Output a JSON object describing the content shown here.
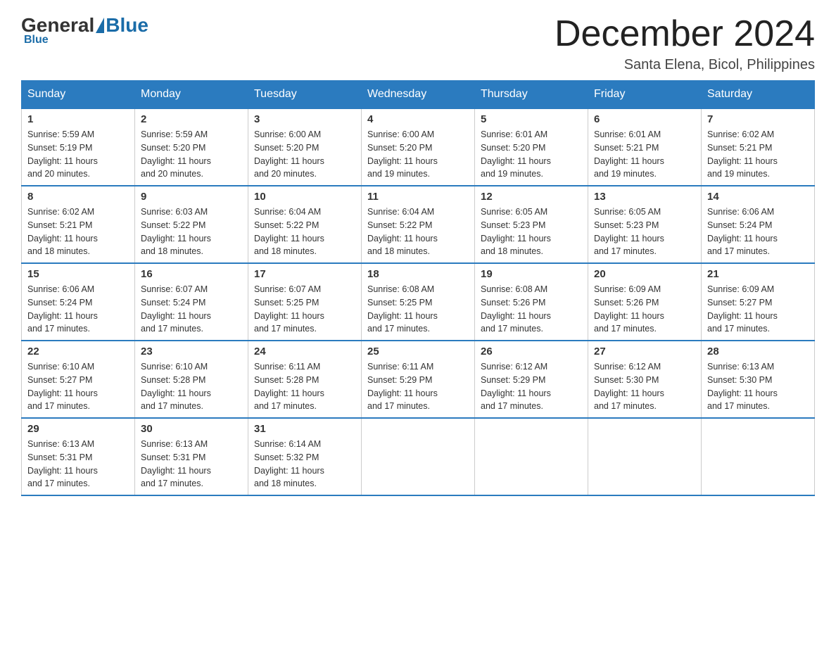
{
  "header": {
    "logo_general": "General",
    "logo_blue": "Blue",
    "month_title": "December 2024",
    "location": "Santa Elena, Bicol, Philippines"
  },
  "days_of_week": [
    "Sunday",
    "Monday",
    "Tuesday",
    "Wednesday",
    "Thursday",
    "Friday",
    "Saturday"
  ],
  "weeks": [
    [
      {
        "day": "1",
        "sunrise": "5:59 AM",
        "sunset": "5:19 PM",
        "daylight": "11 hours and 20 minutes."
      },
      {
        "day": "2",
        "sunrise": "5:59 AM",
        "sunset": "5:20 PM",
        "daylight": "11 hours and 20 minutes."
      },
      {
        "day": "3",
        "sunrise": "6:00 AM",
        "sunset": "5:20 PM",
        "daylight": "11 hours and 20 minutes."
      },
      {
        "day": "4",
        "sunrise": "6:00 AM",
        "sunset": "5:20 PM",
        "daylight": "11 hours and 19 minutes."
      },
      {
        "day": "5",
        "sunrise": "6:01 AM",
        "sunset": "5:20 PM",
        "daylight": "11 hours and 19 minutes."
      },
      {
        "day": "6",
        "sunrise": "6:01 AM",
        "sunset": "5:21 PM",
        "daylight": "11 hours and 19 minutes."
      },
      {
        "day": "7",
        "sunrise": "6:02 AM",
        "sunset": "5:21 PM",
        "daylight": "11 hours and 19 minutes."
      }
    ],
    [
      {
        "day": "8",
        "sunrise": "6:02 AM",
        "sunset": "5:21 PM",
        "daylight": "11 hours and 18 minutes."
      },
      {
        "day": "9",
        "sunrise": "6:03 AM",
        "sunset": "5:22 PM",
        "daylight": "11 hours and 18 minutes."
      },
      {
        "day": "10",
        "sunrise": "6:04 AM",
        "sunset": "5:22 PM",
        "daylight": "11 hours and 18 minutes."
      },
      {
        "day": "11",
        "sunrise": "6:04 AM",
        "sunset": "5:22 PM",
        "daylight": "11 hours and 18 minutes."
      },
      {
        "day": "12",
        "sunrise": "6:05 AM",
        "sunset": "5:23 PM",
        "daylight": "11 hours and 18 minutes."
      },
      {
        "day": "13",
        "sunrise": "6:05 AM",
        "sunset": "5:23 PM",
        "daylight": "11 hours and 17 minutes."
      },
      {
        "day": "14",
        "sunrise": "6:06 AM",
        "sunset": "5:24 PM",
        "daylight": "11 hours and 17 minutes."
      }
    ],
    [
      {
        "day": "15",
        "sunrise": "6:06 AM",
        "sunset": "5:24 PM",
        "daylight": "11 hours and 17 minutes."
      },
      {
        "day": "16",
        "sunrise": "6:07 AM",
        "sunset": "5:24 PM",
        "daylight": "11 hours and 17 minutes."
      },
      {
        "day": "17",
        "sunrise": "6:07 AM",
        "sunset": "5:25 PM",
        "daylight": "11 hours and 17 minutes."
      },
      {
        "day": "18",
        "sunrise": "6:08 AM",
        "sunset": "5:25 PM",
        "daylight": "11 hours and 17 minutes."
      },
      {
        "day": "19",
        "sunrise": "6:08 AM",
        "sunset": "5:26 PM",
        "daylight": "11 hours and 17 minutes."
      },
      {
        "day": "20",
        "sunrise": "6:09 AM",
        "sunset": "5:26 PM",
        "daylight": "11 hours and 17 minutes."
      },
      {
        "day": "21",
        "sunrise": "6:09 AM",
        "sunset": "5:27 PM",
        "daylight": "11 hours and 17 minutes."
      }
    ],
    [
      {
        "day": "22",
        "sunrise": "6:10 AM",
        "sunset": "5:27 PM",
        "daylight": "11 hours and 17 minutes."
      },
      {
        "day": "23",
        "sunrise": "6:10 AM",
        "sunset": "5:28 PM",
        "daylight": "11 hours and 17 minutes."
      },
      {
        "day": "24",
        "sunrise": "6:11 AM",
        "sunset": "5:28 PM",
        "daylight": "11 hours and 17 minutes."
      },
      {
        "day": "25",
        "sunrise": "6:11 AM",
        "sunset": "5:29 PM",
        "daylight": "11 hours and 17 minutes."
      },
      {
        "day": "26",
        "sunrise": "6:12 AM",
        "sunset": "5:29 PM",
        "daylight": "11 hours and 17 minutes."
      },
      {
        "day": "27",
        "sunrise": "6:12 AM",
        "sunset": "5:30 PM",
        "daylight": "11 hours and 17 minutes."
      },
      {
        "day": "28",
        "sunrise": "6:13 AM",
        "sunset": "5:30 PM",
        "daylight": "11 hours and 17 minutes."
      }
    ],
    [
      {
        "day": "29",
        "sunrise": "6:13 AM",
        "sunset": "5:31 PM",
        "daylight": "11 hours and 17 minutes."
      },
      {
        "day": "30",
        "sunrise": "6:13 AM",
        "sunset": "5:31 PM",
        "daylight": "11 hours and 17 minutes."
      },
      {
        "day": "31",
        "sunrise": "6:14 AM",
        "sunset": "5:32 PM",
        "daylight": "11 hours and 18 minutes."
      },
      null,
      null,
      null,
      null
    ]
  ],
  "labels": {
    "sunrise": "Sunrise:",
    "sunset": "Sunset:",
    "daylight": "Daylight:"
  }
}
